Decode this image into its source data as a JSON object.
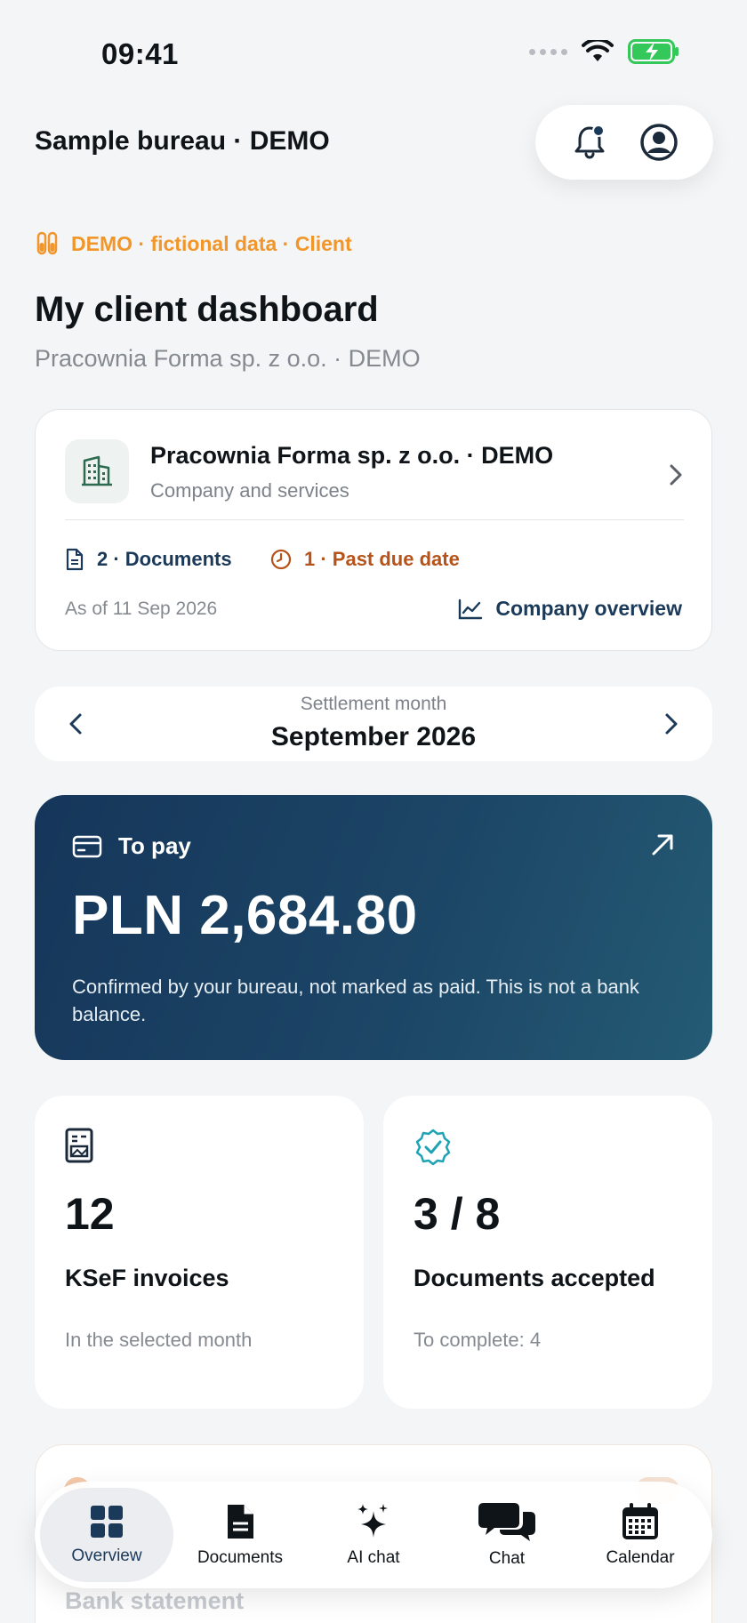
{
  "status_bar": {
    "time": "09:41"
  },
  "header": {
    "bureau_title": "Sample bureau · DEMO"
  },
  "demo_tag": "DEMO · fictional data · Client",
  "page": {
    "title": "My client dashboard",
    "subtitle": "Pracownia Forma sp. z o.o. · DEMO"
  },
  "company_card": {
    "name": "Pracownia Forma sp. z o.o. · DEMO",
    "description": "Company and services",
    "documents": "2 · Documents",
    "past_due": "1 · Past due date",
    "as_of": "As of 11 Sep 2026",
    "overview_link": "Company overview"
  },
  "month_selector": {
    "label": "Settlement month",
    "value": "September 2026"
  },
  "pay_card": {
    "label": "To pay",
    "amount": "PLN 2,684.80",
    "note": "Confirmed by your bureau, not marked as paid. This is not a bank balance."
  },
  "stats": [
    {
      "value": "12",
      "title": "KSeF invoices",
      "subtitle": "In the selected month"
    },
    {
      "value": "3 / 8",
      "title": "Documents accepted",
      "subtitle": "To complete: 4"
    }
  ],
  "faded_card": {
    "label": "Bank statement"
  },
  "tabs": [
    {
      "label": "Overview",
      "active": true
    },
    {
      "label": "Documents",
      "active": false
    },
    {
      "label": "AI chat",
      "active": false
    },
    {
      "label": "Chat",
      "active": false
    },
    {
      "label": "Calendar",
      "active": false
    }
  ],
  "colors": {
    "accent_navy": "#1b3a5a",
    "demo_orange": "#f0962a",
    "past_due_orange": "#b5531b",
    "battery_green": "#34c759",
    "verified_teal": "#1ea3b5"
  }
}
